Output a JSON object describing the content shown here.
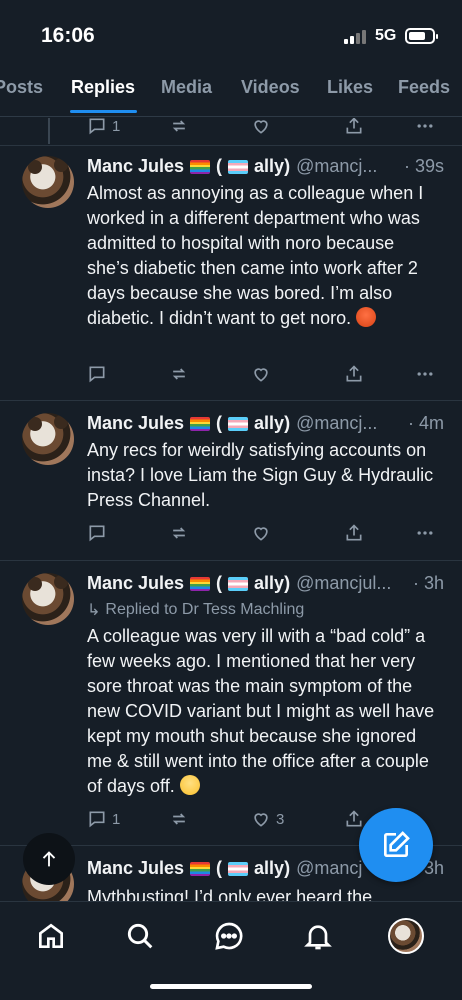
{
  "status_bar": {
    "time": "16:06",
    "network": "5G"
  },
  "tabs": [
    {
      "label": "Posts",
      "active": false
    },
    {
      "label": "Replies",
      "active": true
    },
    {
      "label": "Media",
      "active": false
    },
    {
      "label": "Videos",
      "active": false
    },
    {
      "label": "Likes",
      "active": false
    },
    {
      "label": "Feeds",
      "active": false
    }
  ],
  "colors": {
    "background": "#161e27",
    "accent": "#1f8ef1",
    "muted": "#8d9aa8"
  },
  "top_actions": {
    "reply_count": "1"
  },
  "posts": [
    {
      "name": "Manc Jules",
      "ally": "ally)",
      "handle": "@mancj...",
      "time": "· 39s",
      "text": "Almost as annoying as a colleague when I worked in a different department who was admitted to hospital with noro because she’s diabetic then came into work after 2 days because she was bored. I’m also diabetic. I didn’t want to get noro. ",
      "emoji": "angry-face"
    },
    {
      "name": "Manc Jules",
      "ally": "ally)",
      "handle": "@mancj...",
      "time": "· 4m",
      "text": "Any recs for weirdly satisfying accounts on insta? I love Liam the Sign Guy & Hydraulic Press Channel."
    },
    {
      "name": "Manc Jules",
      "ally": "ally)",
      "handle": "@mancjul...",
      "time": "· 3h",
      "reply_to": "Replied to Dr Tess Machling",
      "text": "A colleague was very ill with a “bad cold” a few weeks ago. I mentioned that her very sore throat was the main symptom of the new COVID variant but I might as well have kept my mouth shut because she ignored me & still went into the office after a couple of days off. ",
      "emoji": "eye-roll-face",
      "reply_count": "1",
      "like_count": "3"
    },
    {
      "name": "Manc Jules",
      "ally": "ally)",
      "handle": "@mancj",
      "time": "3h",
      "text": "Mythbusting! I’d only ever heard the"
    }
  ],
  "bottom_nav": [
    "home-icon",
    "search-icon",
    "chat-icon",
    "bell-icon",
    "profile-avatar"
  ]
}
